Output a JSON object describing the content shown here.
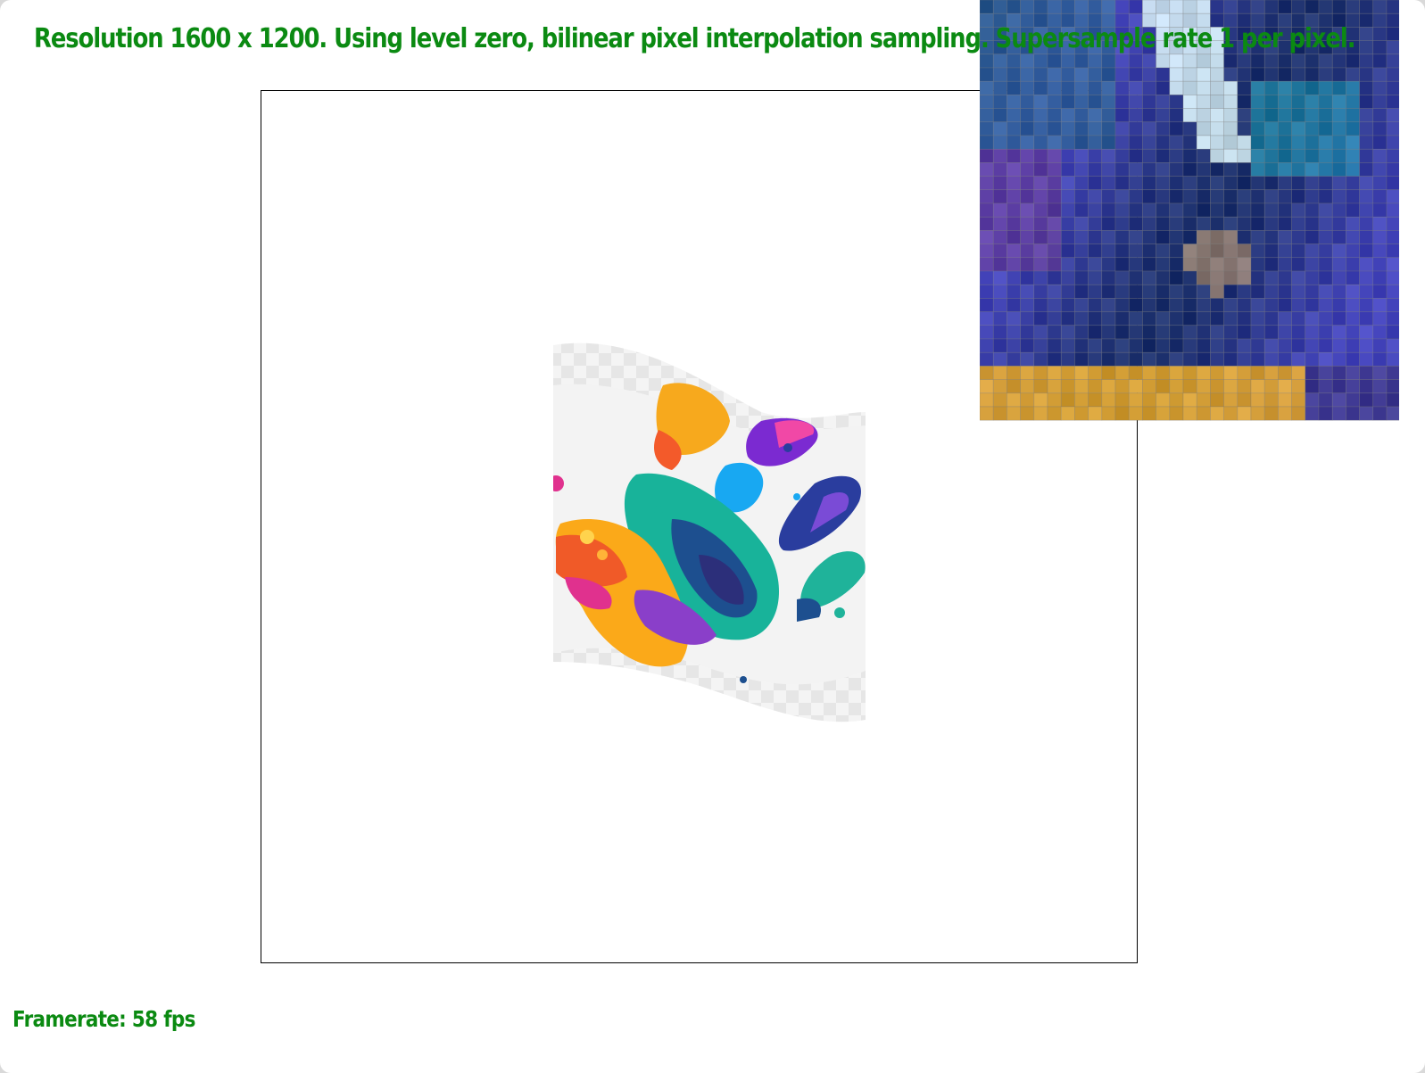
{
  "status": {
    "info_text": "Resolution 1600 x 1200. Using level zero, bilinear pixel interpolation sampling. Supersample rate 1 per pixel.",
    "framerate_text": "Framerate: 58 fps"
  },
  "colors": {
    "text_green": "#0b8a12",
    "viewport_border": "#000000",
    "background": "#ffffff"
  },
  "icons": {
    "texture": "paint-splash-texture",
    "zoom": "pixel-zoom-inspector"
  }
}
